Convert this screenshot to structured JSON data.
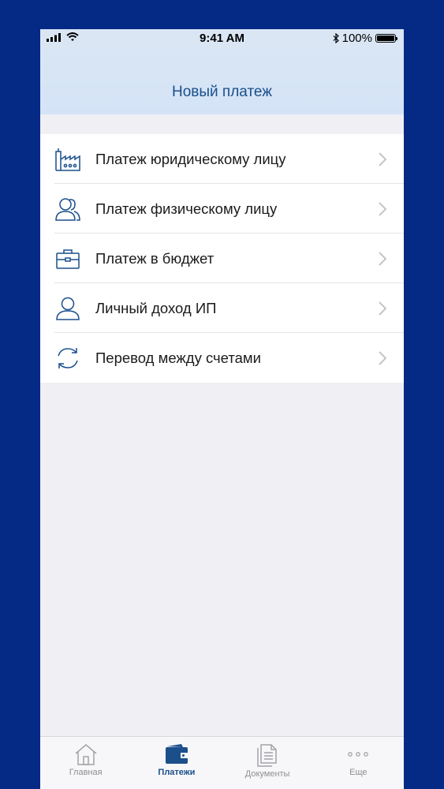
{
  "status_bar": {
    "time": "9:41 AM",
    "battery": "100%"
  },
  "header": {
    "title": "Новый платеж"
  },
  "payment_options": [
    {
      "label": "Платеж юридическому лицу",
      "icon": "factory-icon"
    },
    {
      "label": "Платеж физическому лицу",
      "icon": "users-icon"
    },
    {
      "label": "Платеж в бюджет",
      "icon": "briefcase-icon"
    },
    {
      "label": "Личный доход ИП",
      "icon": "person-icon"
    },
    {
      "label": "Перевод между счетами",
      "icon": "transfer-arrows-icon"
    }
  ],
  "tabbar": {
    "items": [
      {
        "label": "Главная",
        "icon": "home-icon"
      },
      {
        "label": "Платежи",
        "icon": "wallet-icon",
        "active": true
      },
      {
        "label": "Документы",
        "icon": "documents-icon"
      },
      {
        "label": "Еще",
        "icon": "more-icon"
      }
    ]
  },
  "colors": {
    "frame": "#052a86",
    "accent": "#1a4f8b",
    "header_bg": "#d4e4f6",
    "content_bg": "#efeff4"
  }
}
